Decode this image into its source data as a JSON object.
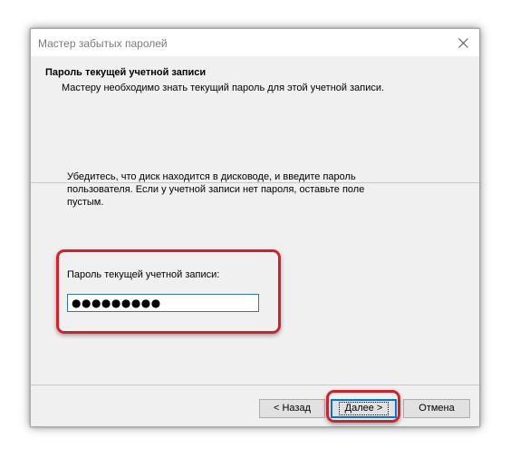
{
  "window": {
    "title": "Мастер забытых паролей"
  },
  "header": {
    "title": "Пароль текущей учетной записи",
    "description": "Мастеру необходимо знать текущий пароль для этой учетной записи."
  },
  "body": {
    "instructions": "Убедитесь, что диск находится в дисководе, и введите пароль пользователя. Если у учетной записи нет пароля, оставьте поле пустым.",
    "password_label": "Пароль текущей учетной записи:",
    "password_value": "●●●●●●●●●"
  },
  "buttons": {
    "back_label": "< Назад",
    "next_label": "Далее >",
    "cancel_label": "Отмена"
  },
  "colors": {
    "highlight": "#d4202a",
    "focus_border": "#0078d7"
  },
  "icons": {
    "close": "close-icon"
  }
}
